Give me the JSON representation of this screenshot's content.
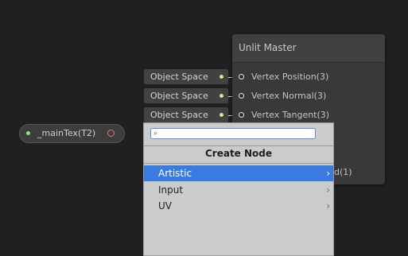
{
  "master_node": {
    "title": "Unlit Master",
    "ports": [
      "Vertex Position(3)",
      "Vertex Normal(3)",
      "Vertex Tangent(3)"
    ],
    "occluded_port_fragment": "d(1)"
  },
  "inline_inputs": [
    "Object Space",
    "Object Space",
    "Object Space"
  ],
  "property_node": {
    "name": "_mainTex(T2)"
  },
  "create_node_popup": {
    "search_value": "",
    "title": "Create Node",
    "items": [
      {
        "label": "Artistic",
        "chevron": "›",
        "selected": true
      },
      {
        "label": "Input",
        "chevron": "›",
        "selected": false
      },
      {
        "label": "UV",
        "chevron": "›",
        "selected": false
      }
    ]
  },
  "colors": {
    "background": "#202020",
    "selection": "#3a7be0",
    "wire": "#e6e08a"
  },
  "icons": {
    "search": "search-icon",
    "chevron": "chevron-right-icon"
  }
}
